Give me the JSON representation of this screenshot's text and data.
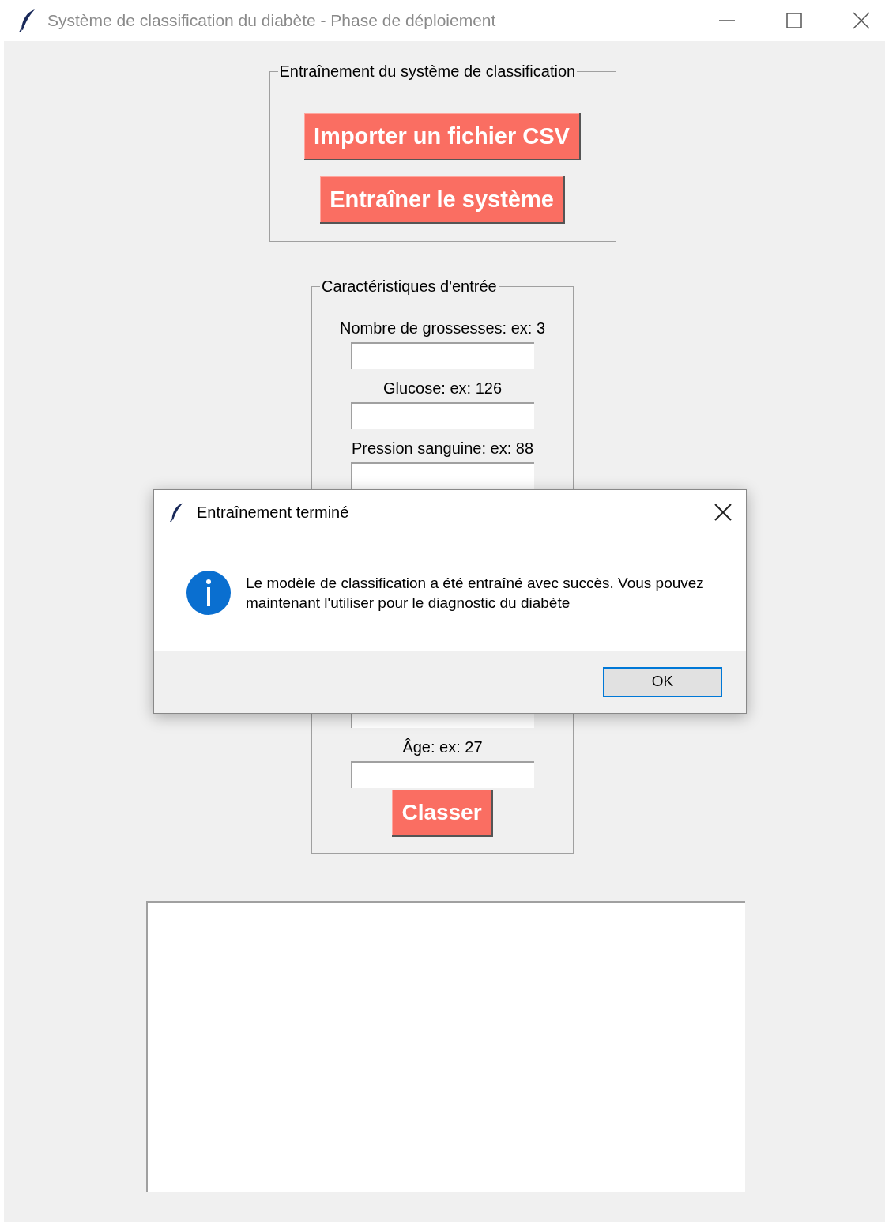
{
  "window": {
    "title": "Système de classification du diabète - Phase de déploiement"
  },
  "training": {
    "title": "Entraînement du système de classification",
    "buttons": [
      "Importer un fichier CSV",
      "Entraîner le système"
    ]
  },
  "input_form": {
    "title": "Caractéristiques d'entrée",
    "fields_above": [
      {
        "label": "Nombre de grossesses: ex: 3"
      },
      {
        "label": "Glucose: ex: 126"
      },
      {
        "label": "Pression sanguine: ex: 88"
      }
    ],
    "fields_below": [
      {
        "label": "Âge: ex: 27"
      }
    ],
    "button": "Classer"
  },
  "dialog": {
    "title": "Entraînement terminé",
    "message": "Le modèle de classification a été entraîné avec succès. Vous pouvez maintenant l'utiliser pour le diagnostic du diabète",
    "button": "OK"
  }
}
